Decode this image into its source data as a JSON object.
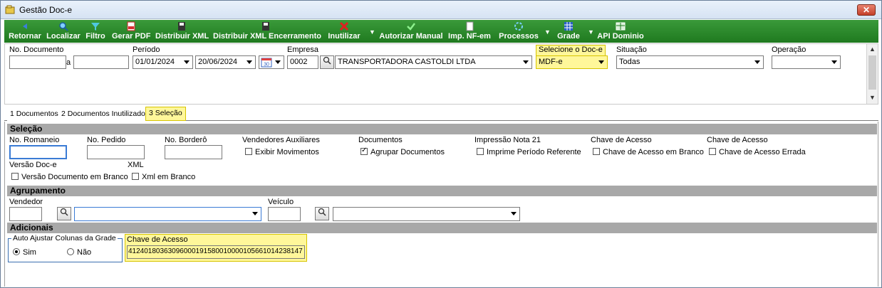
{
  "window": {
    "title": "Gestão Doc-e",
    "close_label": "✕"
  },
  "toolbar": {
    "buttons": [
      {
        "label": "Retornar",
        "icon": "return-arrow-icon"
      },
      {
        "label": "Localizar",
        "icon": "search-icon"
      },
      {
        "label": "Filtro",
        "icon": "funnel-icon"
      },
      {
        "label": "Gerar PDF",
        "icon": "pdf-icon"
      },
      {
        "label": "Distribuir XML",
        "icon": "floppy-icon"
      },
      {
        "label": "Distribuir XML Encerramento",
        "icon": "floppy-icon"
      },
      {
        "label": "Inutilizar",
        "icon": "red-x-icon"
      },
      {
        "label": "Autorizar Manual",
        "icon": "green-check-icon"
      },
      {
        "label": "Imp. NF-em",
        "icon": "document-icon"
      },
      {
        "label": "Processos",
        "icon": "refresh-icon"
      },
      {
        "label": "Grade",
        "icon": "grid-icon"
      },
      {
        "label": "API Dominio",
        "icon": "table-icon"
      }
    ],
    "dropdown_arrow": "▼"
  },
  "filters": {
    "no_documento": {
      "label": "No. Documento",
      "from": "",
      "to": "",
      "separator": "a"
    },
    "periodo": {
      "label": "Período",
      "start": "01/01/2024",
      "end": "20/06/2024",
      "calendar_badge": "30"
    },
    "empresa": {
      "label": "Empresa",
      "code": "0002",
      "name": "TRANSPORTADORA CASTOLDI LTDA"
    },
    "doc_e": {
      "label": "Selecione o Doc-e",
      "value": "MDF-e"
    },
    "situacao": {
      "label": "Situação",
      "value": "Todas"
    },
    "operacao": {
      "label": "Operação",
      "value": ""
    }
  },
  "tabs": [
    {
      "label": "1 Documentos",
      "active": false
    },
    {
      "label": "2 Documentos Inutilizados",
      "active": false
    },
    {
      "label": "3 Seleção",
      "active": true
    }
  ],
  "selecao": {
    "header": "Seleção",
    "no_romaneio": "No. Romaneio",
    "no_pedido": "No. Pedido",
    "no_bordero": "No. Borderô",
    "vendedores_aux": {
      "label": "Vendedores Auxiliares",
      "check": "Exibir Movimentos",
      "checked": false
    },
    "documentos": {
      "label": "Documentos",
      "check": "Agrupar Documentos",
      "checked": true
    },
    "impressao": {
      "label": "Impressão Nota 21",
      "check": "Imprime Período Referente",
      "checked": false
    },
    "chave1": {
      "label": "Chave de Acesso",
      "check": "Chave de Acesso em Branco",
      "checked": false
    },
    "chave2": {
      "label": "Chave de Acesso",
      "check": "Chave de Acesso Errada",
      "checked": false
    },
    "versao": {
      "label": "Versão Doc-e",
      "check": "Versão Documento em Branco",
      "checked": false
    },
    "xml": {
      "label": "XML",
      "check": "Xml em Branco",
      "checked": false
    }
  },
  "agrupamento": {
    "header": "Agrupamento",
    "vendedor_label": "Vendedor",
    "veiculo_label": "Veículo"
  },
  "adicionais": {
    "header": "Adicionais",
    "auto_ajustar": {
      "label": "Auto Ajustar Colunas da Grade",
      "sim": "Sim",
      "nao": "Não",
      "selected": "Sim"
    },
    "chave_acesso": {
      "label": "Chave de Acesso",
      "value": "41240180363096000191580010000105661014238147"
    }
  },
  "colors": {
    "toolbar_green": "#2a8a2a",
    "highlight": "#fff79a",
    "section_gray": "#a8a8a8"
  }
}
